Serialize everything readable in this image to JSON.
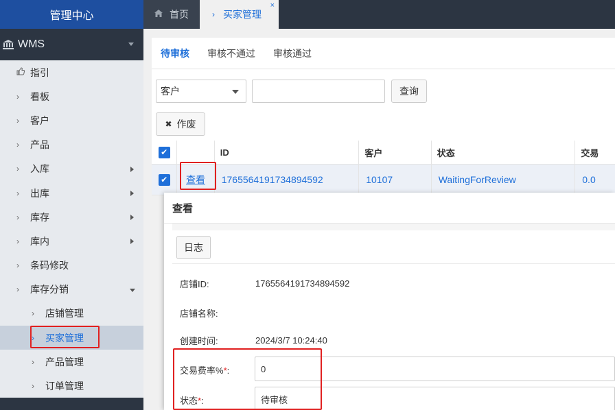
{
  "sidebar": {
    "title": "管理中心",
    "app_name": "WMS",
    "items": [
      {
        "label": "指引"
      },
      {
        "label": "看板"
      },
      {
        "label": "客户"
      },
      {
        "label": "产品"
      },
      {
        "label": "入库"
      },
      {
        "label": "出库"
      },
      {
        "label": "库存"
      },
      {
        "label": "库内"
      },
      {
        "label": "条码修改"
      },
      {
        "label": "库存分销"
      }
    ],
    "sub_items": [
      {
        "label": "店铺管理"
      },
      {
        "label": "买家管理"
      },
      {
        "label": "产品管理"
      },
      {
        "label": "订单管理"
      }
    ]
  },
  "tabs": {
    "home": "首页",
    "active": "买家管理",
    "close": "×"
  },
  "subtabs": [
    "待审核",
    "审核不通过",
    "审核通过"
  ],
  "filter": {
    "select_value": "客户",
    "search_button": "查询",
    "void_button": "作废"
  },
  "table": {
    "headers": [
      "ID",
      "客户",
      "状态",
      "交易"
    ],
    "row": {
      "action": "查看",
      "id": "1765564191734894592",
      "customer": "10107",
      "status": "WaitingForReview",
      "fee": "0.0"
    }
  },
  "modal": {
    "title": "查看",
    "log_button": "日志",
    "fields": {
      "shop_id_label": "店铺ID:",
      "shop_id_value": "1765564191734894592",
      "shop_name_label": "店铺名称:",
      "created_label": "创建时间:",
      "created_value": "2024/3/7 10:24:40",
      "fee_label": "交易费率%",
      "fee_value": "0",
      "status_label": "状态",
      "status_value": "待审核",
      "required_mark": "*",
      "colon": ":"
    }
  },
  "colors": {
    "accent": "#1e6fd9",
    "header_blue": "#1e4fa0",
    "dark": "#2c3542",
    "highlight": "#e02020"
  }
}
